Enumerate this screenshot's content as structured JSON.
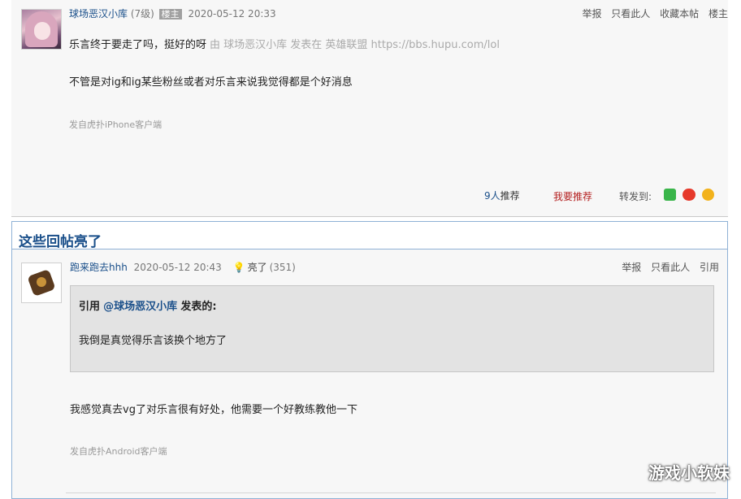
{
  "main_post": {
    "author": "球场恶汉小库",
    "level": "(7级)",
    "owner_badge": "楼主",
    "date": "2020-05-12 20:33",
    "actions": [
      "举报",
      "只看此人",
      "收藏本帖",
      "楼主"
    ],
    "title": "乐言终于要走了吗，挺好的呀",
    "source": "由 球场恶汉小库 发表在 英雄联盟 https://bbs.hupu.com/lol",
    "body": "不管是对ig和ig某些粉丝或者对乐言来说我觉得都是个好消息",
    "device": "发自虎扑iPhone客户端",
    "recommend_count": "9人",
    "recommend_label": "推荐",
    "want_recommend": "我要推荐",
    "share_label": "转发到:",
    "share_icons": [
      "wechat-icon",
      "weibo-icon",
      "qzone-icon"
    ]
  },
  "highlights": {
    "title": "这些回帖亮了",
    "reply": {
      "author": "跑来跑去hhh",
      "date": "2020-05-12 20:43",
      "light_label": "亮了",
      "light_count": "(351)",
      "actions": [
        "举报",
        "只看此人",
        "引用"
      ],
      "quote_prefix": "引用",
      "quote_user": "@球场恶汉小库",
      "quote_suffix": "发表的:",
      "quote_body": "我倒是真觉得乐言该换个地方了",
      "body": "我感觉真去vg了对乐言很有好处，他需要一个好教练教他一下",
      "device": "发自虎扑Android客户端"
    }
  },
  "watermark": "游戏小软妹",
  "colors": {
    "link_blue": "#1a4f8a",
    "recommend_red": "#b42020",
    "highlight_border": "#8fb1d5"
  }
}
